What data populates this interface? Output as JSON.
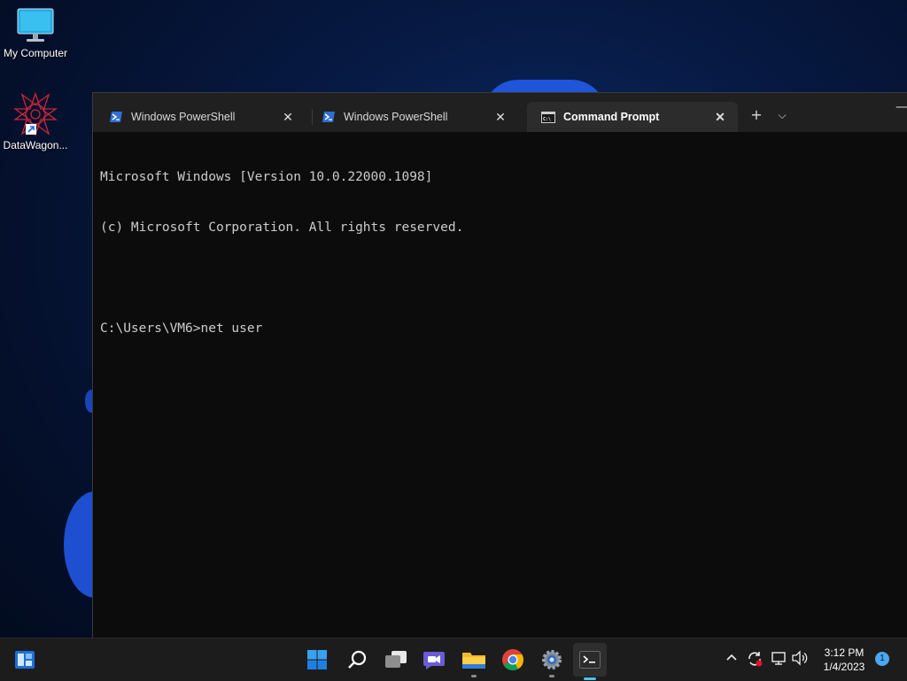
{
  "desktop": {
    "icons": [
      {
        "label": "My Computer",
        "icon": "monitor-icon"
      },
      {
        "label": "DataWagon...",
        "icon": "datawagon-app-icon"
      }
    ]
  },
  "terminal": {
    "tabs": [
      {
        "label": "Windows PowerShell",
        "icon": "powershell-icon",
        "active": false
      },
      {
        "label": "Windows PowerShell",
        "icon": "powershell-icon",
        "active": false
      },
      {
        "label": "Command Prompt",
        "icon": "cmd-icon",
        "active": true
      }
    ],
    "new_tab_label": "+",
    "dropdown_label": "⌵",
    "minimize_label": "—",
    "console_lines": [
      "Microsoft Windows [Version 10.0.22000.1098]",
      "(c) Microsoft Corporation. All rights reserved.",
      "",
      "C:\\Users\\VM6>net user"
    ]
  },
  "taskbar": {
    "items": [
      "widgets-icon",
      "start-icon",
      "search-icon",
      "task-view-icon",
      "teams-chat-icon",
      "file-explorer-icon",
      "chrome-icon",
      "settings-icon",
      "terminal-icon"
    ],
    "clock": {
      "time": "3:12 PM",
      "date": "1/4/2023"
    },
    "notification_count": "1"
  },
  "colors": {
    "terminal_bg": "#0c0c0c",
    "tabbar_bg": "#202020",
    "taskbar_bg": "#1c1c1c",
    "accent": "#4fc3f7"
  }
}
